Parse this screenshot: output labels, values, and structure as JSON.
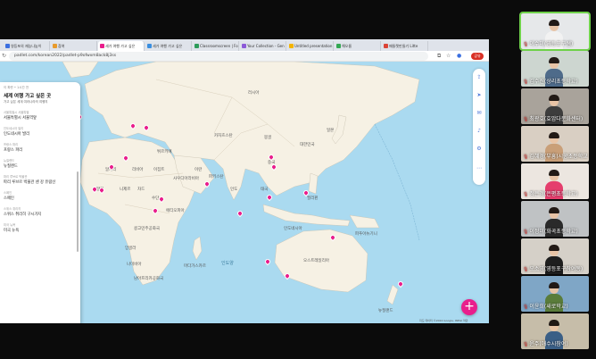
{
  "browser": {
    "tabs": [
      {
        "label": "영등포의 재능나눔이",
        "color": "#3b6fe0"
      },
      {
        "label": "참여",
        "color": "#e89b2c"
      },
      {
        "label": "세가 여행 가고 싶은",
        "color": "#e91e8c"
      },
      {
        "label": "세가 여행 가고 싶은",
        "color": "#3b8fe0"
      },
      {
        "label": "Classroomscreen | Fo",
        "color": "#2e9c5a"
      },
      {
        "label": "Your Collection - Gen",
        "color": "#8c5ad8"
      },
      {
        "label": "Untitled presentation",
        "color": "#f4b400"
      },
      {
        "label": "해오름",
        "color": "#34a853"
      },
      {
        "label": "패들렛만들기 Litte",
        "color": "#db4437"
      }
    ],
    "url": "padlet.com/korean2022/padlet-p9ofwxm8ack8j3ss",
    "profile_label": "공유"
  },
  "panel": {
    "meta": "이 파란 • 1시간 전",
    "title": "세계 여행 가고 싶은 곳",
    "subtitle": "가고 싶은 세계 여러나라의 여행지",
    "entries": [
      {
        "loc": "서울특별시 서울특별",
        "txt": "서울특별시 서울역앞"
      },
      {
        "loc": "인도네시아 발리",
        "txt": "인도네시아 발리"
      },
      {
        "loc": "프랑스 파리",
        "txt": "프랑스 파리"
      },
      {
        "loc": "뉴질랜드",
        "txt": "뉴질랜드"
      },
      {
        "loc": "파리 루브르 박물관",
        "txt": "파리 루브르 박물관 센 강 유람선"
      },
      {
        "loc": "스페인",
        "txt": "스페인"
      },
      {
        "loc": "스위스 취리히",
        "txt": "스위스 취리히 구시가지"
      },
      {
        "loc": "미국 뉴욕",
        "txt": "미국 뉴욕"
      }
    ],
    "footer": "⊖ ⊕ ≡"
  },
  "map": {
    "labels": {
      "russia": "러시아",
      "kazakhstan": "카자흐스탄",
      "mongolia": "몽골",
      "china": "중국",
      "india": "인도",
      "iran": "이란",
      "saudi": "사우디아라비아",
      "egypt": "이집트",
      "libya": "리비아",
      "algeria": "알제리",
      "mali": "말리",
      "niger": "니제르",
      "chad": "차드",
      "sudan": "수단",
      "ethiopia": "에티오피아",
      "drc": "콩고민주공화국",
      "angola": "앙골라",
      "namibia": "나미비아",
      "south_africa": "남아프리카공화국",
      "madagascar": "마다가스카르",
      "indonesia": "인도네시아",
      "australia": "오스트레일리아",
      "japan": "일본",
      "korea": "대한민국",
      "turkey": "튀르키예",
      "pakistan": "파키스탄",
      "thailand": "태국",
      "philippines": "필리핀",
      "png": "파푸아뉴기니",
      "nz": "뉴질랜드",
      "ocean": "인도양"
    },
    "attribution": "지도 데이터 ©2024 Google, INEGI  약관"
  },
  "toolbar_icons": [
    "share-icon",
    "send-icon",
    "chat-icon",
    "bell-icon",
    "settings-icon",
    "more-icon"
  ],
  "fab_label": "+",
  "participants": [
    {
      "name": "이수미(영등포구쌤)",
      "shirt": "#f2f2f2",
      "bg": "#e6e8ea",
      "active": true
    },
    {
      "name": "김수진(상리초등학교)",
      "shirt": "#4e6b8a",
      "bg": "#cdd6d0",
      "active": false
    },
    {
      "name": "최광호(효암다문화센터)",
      "shirt": "#3d3d3d",
      "bg": "#a9a39b",
      "active": false
    },
    {
      "name": "김혜경(부흥)시공초등학교",
      "shirt": "#c99f78",
      "bg": "#d9cfc3",
      "active": false
    },
    {
      "name": "정은경(은평초등학교)",
      "shirt": "#e53e6d",
      "bg": "#ece6e0",
      "active": false
    },
    {
      "name": "이정미(화곡초등학교)",
      "shirt": "#2a2a2a",
      "bg": "#bfc2c4",
      "active": false
    },
    {
      "name": "오소영(영등포구참여동)",
      "shirt": "#1e1e1e",
      "bg": "#d5d0c8",
      "active": false
    },
    {
      "name": "이윤희(새로학교)",
      "shirt": "#5a7c3a",
      "bg": "#7fa6c6",
      "active": false
    },
    {
      "name": "윤주(애수시참여)",
      "shirt": "#3a5f86",
      "bg": "#c6bda9",
      "active": false
    }
  ]
}
